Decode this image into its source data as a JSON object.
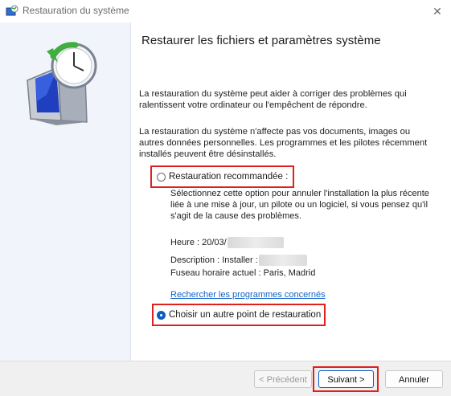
{
  "window": {
    "title": "Restauration du système",
    "close_glyph": "✕"
  },
  "main": {
    "heading": "Restaurer les fichiers et paramètres système",
    "paragraph1": "La restauration du système peut aider à corriger des problèmes qui ralentissent votre ordinateur ou l'empêchent de répondre.",
    "paragraph2": "La restauration du système n'affecte pas vos documents, images ou autres données personnelles. Les programmes et les pilotes récemment installés peuvent être désinstallés.",
    "recommended": {
      "label": "Restauration recommandée :",
      "selected": false,
      "description": "Sélectionnez cette option pour annuler l'installation la plus récente liée à une mise à jour, un pilote ou un logiciel, si vous pensez qu'il s'agit de la cause des problèmes.",
      "time_label": "Heure : 20/03/",
      "description_label": "Description : Installer : ",
      "timezone_label": "Fuseau horaire actuel : Paris, Madrid"
    },
    "link": "Rechercher les programmes concernés",
    "other": {
      "label": "Choisir un autre point de restauration",
      "selected": true
    }
  },
  "footer": {
    "previous": "< Précédent",
    "next": "Suivant >",
    "cancel": "Annuler"
  },
  "colors": {
    "accent": "#0b5cc3",
    "highlight": "#e0201f",
    "link": "#1363c4"
  },
  "icons": {
    "app": "system-restore-icon",
    "hero": "computer-restore-clock-icon"
  }
}
